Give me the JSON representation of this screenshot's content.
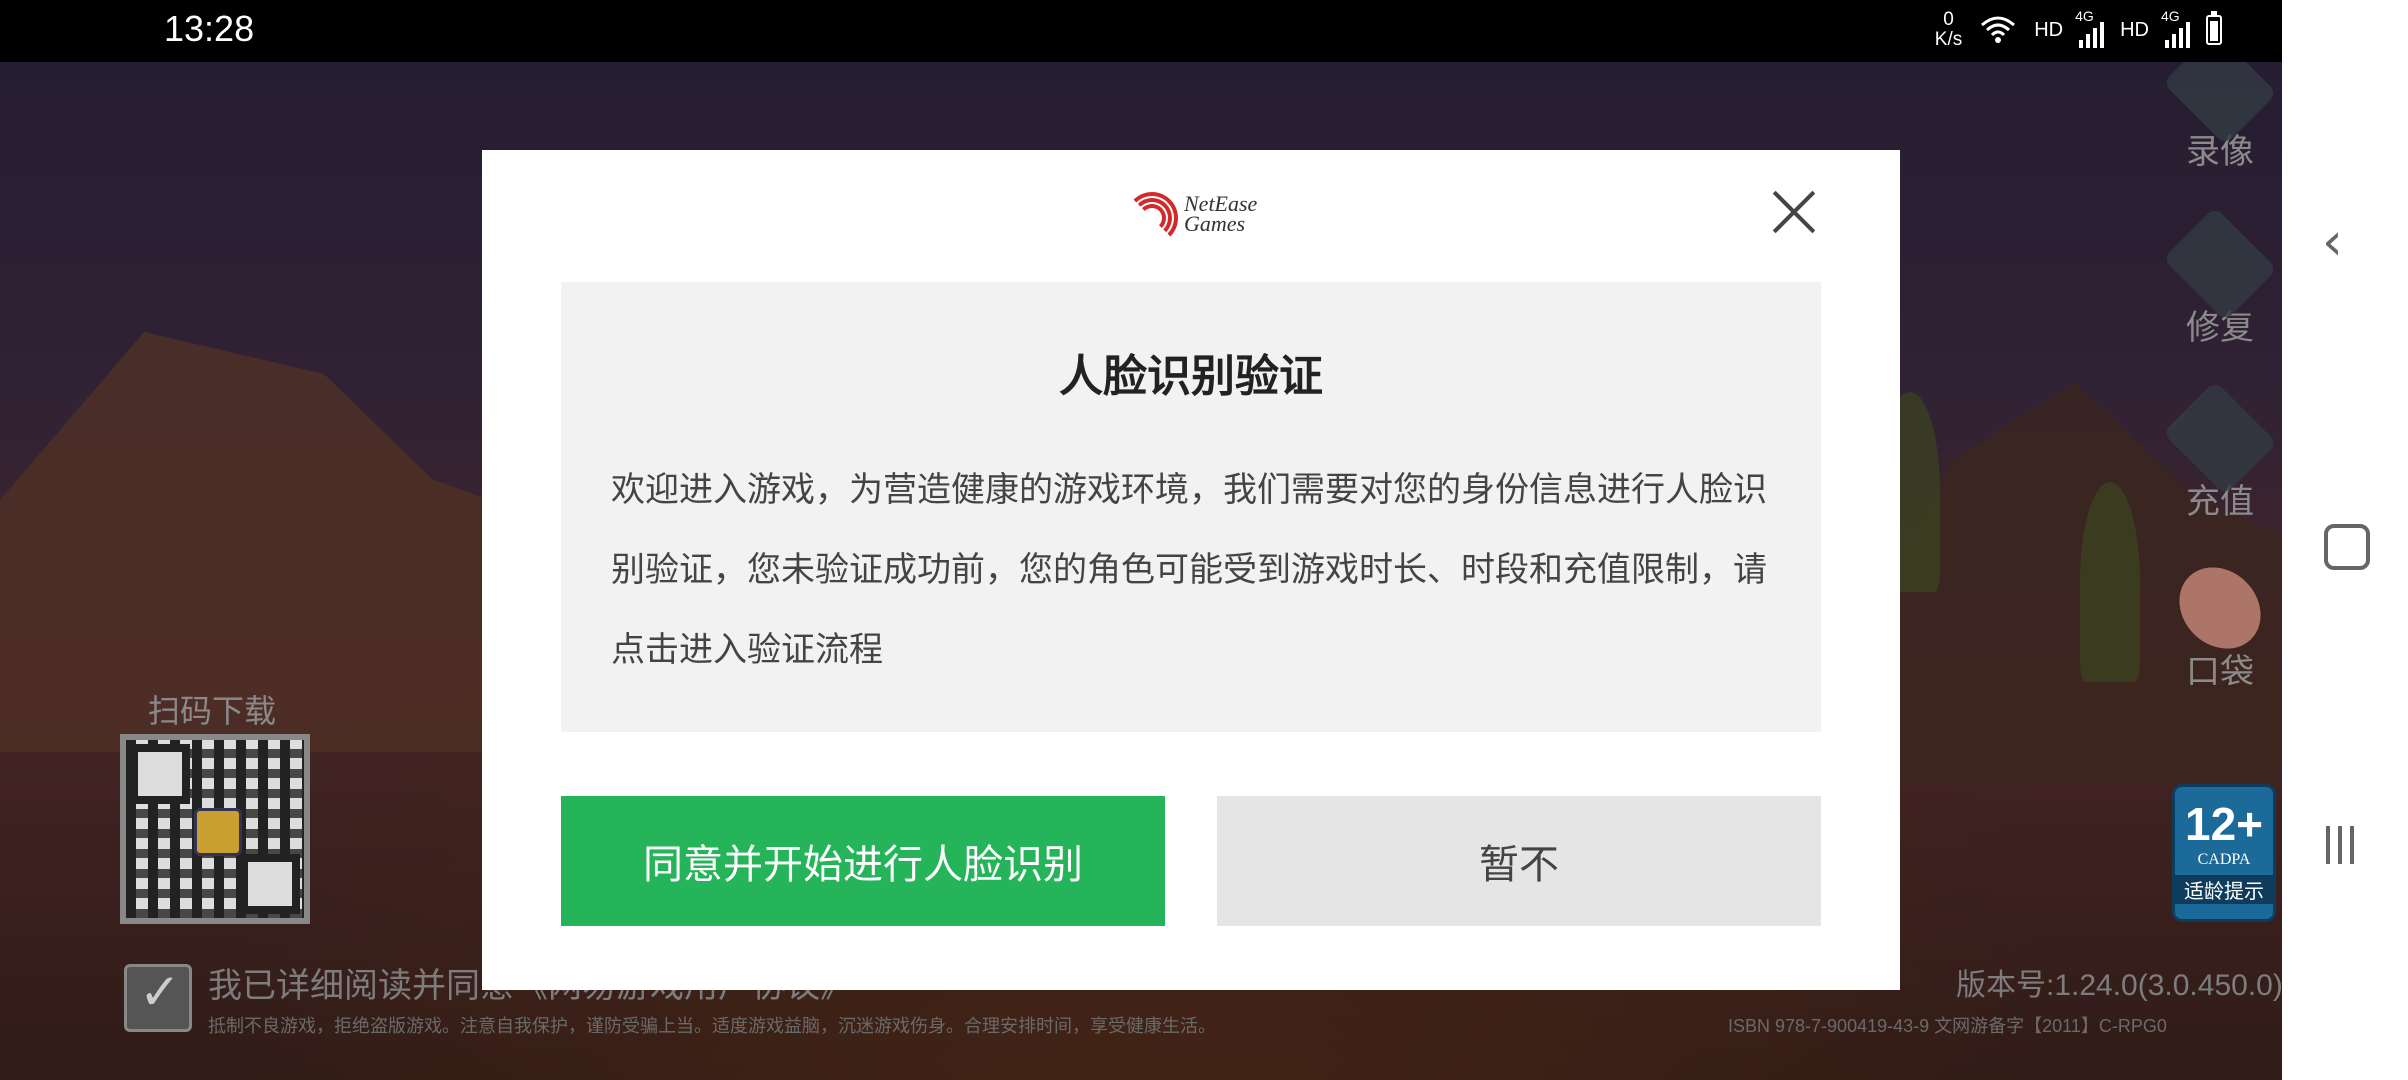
{
  "status_bar": {
    "time": "13:28",
    "net_speed_value": "0",
    "net_speed_unit": "K/s",
    "hd1": "HD",
    "sig1_label": "4G",
    "hd2": "HD",
    "sig2_label": "4G"
  },
  "game": {
    "qr_label": "扫码下载",
    "agree_text": "我已详细阅读并同意《网易游戏用户协议》",
    "health_notice": "抵制不良游戏，拒绝盗版游戏。注意自我保护，谨防受骗上当。适度游戏益脑，沉迷游戏伤身。合理安排时间，享受健康生活。",
    "version": "版本号:1.24.0(3.0.450.0)",
    "isbn": "ISBN 978-7-900419-43-9    文网游备字【2011】C-RPG0",
    "side_menu": {
      "record": "录像",
      "repair": "修复",
      "recharge": "充值",
      "pocket": "口袋"
    },
    "age_badge": {
      "number": "12+",
      "org": "CADPA",
      "hint": "适龄提示"
    }
  },
  "dialog": {
    "logo_line1": "NetEase",
    "logo_line2": "Games",
    "title": "人脸识别验证",
    "body": "欢迎进入游戏，为营造健康的游戏环境，我们需要对您的身份信息进行人脸识别验证，您未验证成功前，您的角色可能受到游戏时长、时段和充值限制，请点击进入验证流程",
    "agree_button": "同意并开始进行人脸识别",
    "later_button": "暂不"
  },
  "colors": {
    "agree_button_bg": "#25b45a",
    "later_button_bg": "#e5e5e5",
    "logo_red": "#d02a2a"
  },
  "icons": [
    "wifi-icon",
    "signal-icon",
    "battery-icon",
    "close-icon",
    "netease-logo-icon",
    "qr-code",
    "check-icon",
    "video-icon",
    "wrench-icon",
    "card-icon",
    "back-icon",
    "home-icon",
    "recents-icon"
  ]
}
